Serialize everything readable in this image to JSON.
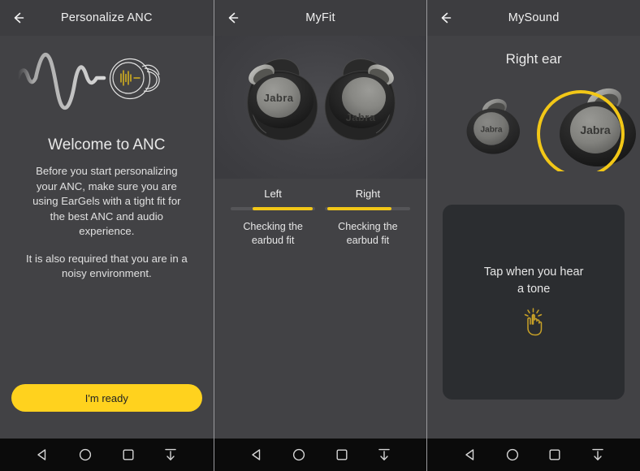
{
  "panels": [
    {
      "id": "personalize-anc",
      "header": {
        "title": "Personalize ANC",
        "back_icon": "arrow-left-icon"
      },
      "illustration": {
        "name": "anc-waveform-earbud-illustration",
        "wave_color": "#c9c9c9",
        "accent_color": "#F2C717"
      },
      "title": "Welcome to ANC",
      "paragraphs": [
        "Before you start personalizing your ANC, make sure you are using EarGels with a tight fit for the best ANC and audio experience.",
        "It is also required that you are in a noisy environment."
      ],
      "cta": {
        "label": "I'm ready",
        "color": "#FFD21E",
        "text_color": "#222222"
      }
    },
    {
      "id": "myfit",
      "header": {
        "title": "MyFit",
        "back_icon": "arrow-left-icon"
      },
      "illustration": {
        "name": "two-earbuds-image",
        "brand_text": "Jabra"
      },
      "columns": [
        {
          "side": "Left",
          "status": "Checking the earbud fit",
          "progress_start_pct": 26,
          "progress_end_pct": 97
        },
        {
          "side": "Right",
          "status": "Checking the earbud fit",
          "progress_start_pct": 2,
          "progress_end_pct": 78
        }
      ],
      "progress_color": "#F2C717",
      "track_color": "#555558"
    },
    {
      "id": "mysound",
      "header": {
        "title": "MySound",
        "back_icon": "arrow-left-icon"
      },
      "title": "Right ear",
      "earbuds": [
        {
          "label": "left-earbud",
          "selected": false,
          "brand_text": "Jabra"
        },
        {
          "label": "right-earbud",
          "selected": true,
          "brand_text": "Jabra"
        }
      ],
      "selection_ring_color": "#F2C717",
      "card": {
        "text_line1": "Tap when you hear",
        "text_line2": "a tone",
        "icon": "tap-hand-icon",
        "icon_color": "#C9A227",
        "background": "#2b2d30"
      }
    }
  ],
  "navbar": {
    "buttons": [
      {
        "name": "nav-back-button",
        "icon": "triangle-left-icon"
      },
      {
        "name": "nav-home-button",
        "icon": "circle-icon"
      },
      {
        "name": "nav-recents-button",
        "icon": "square-icon"
      },
      {
        "name": "nav-hide-keyboard-button",
        "icon": "arrow-down-bar-icon"
      }
    ]
  }
}
